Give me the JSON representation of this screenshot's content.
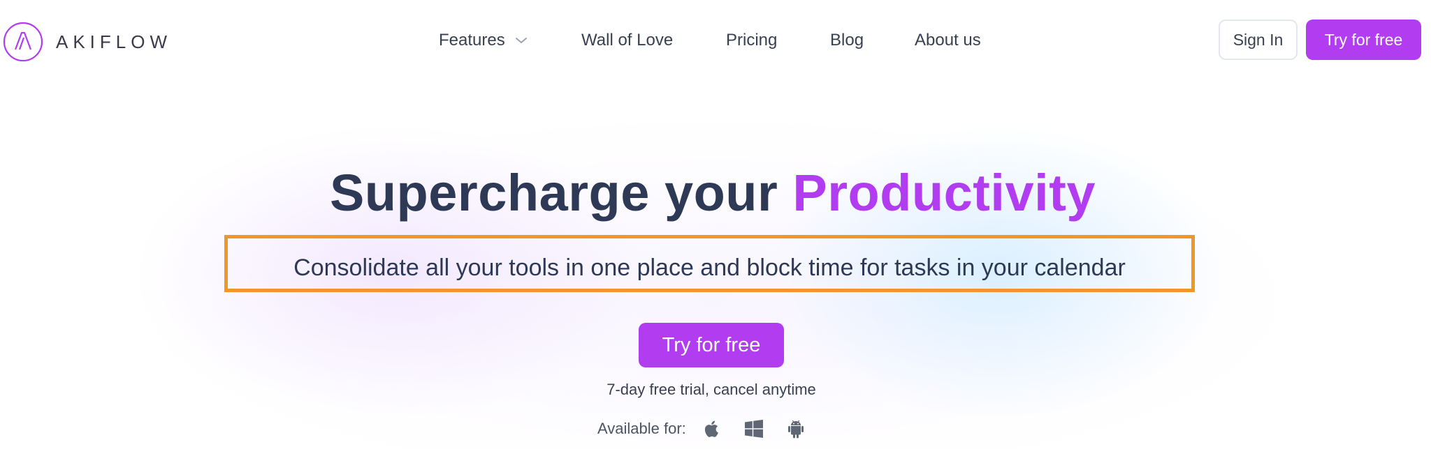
{
  "brand": {
    "name": "AKIFLOW",
    "accent_color": "#b13cf0",
    "logo_icon": "akiflow-logo-icon"
  },
  "nav": {
    "items": [
      {
        "label": "Features",
        "has_dropdown": true,
        "icon": "chevron-down-icon"
      },
      {
        "label": "Wall of Love"
      },
      {
        "label": "Pricing"
      },
      {
        "label": "Blog"
      },
      {
        "label": "About us"
      }
    ]
  },
  "header_actions": {
    "signin_label": "Sign In",
    "try_label": "Try for free"
  },
  "hero": {
    "title_prefix": "Supercharge your ",
    "title_accent": "Productivity",
    "subtitle": "Consolidate all your tools in one place and block time for tasks in your calendar",
    "highlight_color": "#f0962a",
    "cta_label": "Try for free",
    "trial_note": "7-day free trial, cancel anytime",
    "available_label": "Available for:",
    "platforms": [
      {
        "icon": "apple-icon"
      },
      {
        "icon": "windows-icon"
      },
      {
        "icon": "android-icon"
      }
    ]
  }
}
